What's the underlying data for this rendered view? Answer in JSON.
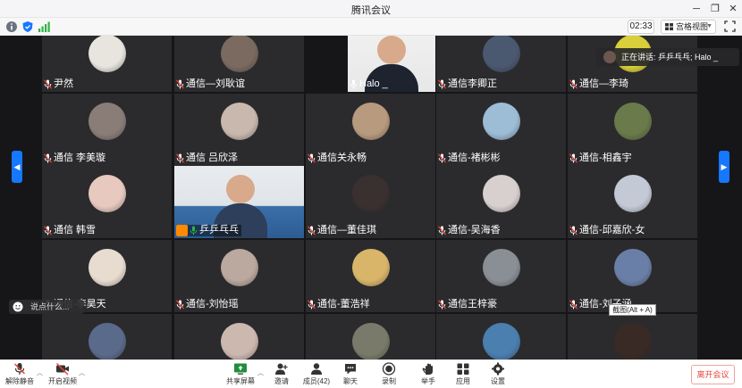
{
  "window": {
    "title": "腾讯会议"
  },
  "toolbar": {
    "timer": "02:33",
    "view_label": "宫格视图"
  },
  "grid": {
    "rows": [
      [
        {
          "name": "尹然",
          "avatar_color": "#e8e4de"
        },
        {
          "name": "通信—刘耿谊",
          "avatar_color": "#7a6a60"
        },
        {
          "name": "Halo _",
          "avatar_color": "#3a4a5a",
          "camera": true
        },
        {
          "name": "通信李卿正",
          "avatar_color": "#4a5870"
        },
        {
          "name": "通信—李琦",
          "avatar_color": "#d9cf3a"
        }
      ],
      [
        {
          "name": "通信 李美璇",
          "avatar_color": "#8a7d78"
        },
        {
          "name": "通信 吕欣泽",
          "avatar_color": "#c9b8ad"
        },
        {
          "name": "通信关永畅",
          "avatar_color": "#b89a7e"
        },
        {
          "name": "通信-褚彬彬",
          "avatar_color": "#9dbcd6"
        },
        {
          "name": "通信-相鑫宇",
          "avatar_color": "#6a7a4a"
        }
      ],
      [
        {
          "name": "通信 韩雪",
          "avatar_color": "#e7c9c0"
        },
        {
          "name": "乒乒乓乓",
          "avatar_color": "#3b5f8a",
          "camera": true,
          "active": true
        },
        {
          "name": "通信—董佳琪",
          "avatar_color": "#3a3030"
        },
        {
          "name": "通信-吴海香",
          "avatar_color": "#d8cfcf"
        },
        {
          "name": "通信-邱嘉欣-女",
          "avatar_color": "#c4c9d6"
        }
      ],
      [
        {
          "name": "通信-李昊天",
          "avatar_color": "#e8dcd0"
        },
        {
          "name": "通信-刘怡瑶",
          "avatar_color": "#bba89e"
        },
        {
          "name": "通信-董浩祥",
          "avatar_color": "#d9b56a"
        },
        {
          "name": "通信王梓豪",
          "avatar_color": "#8a8f95"
        },
        {
          "name": "通信-刘子涵",
          "avatar_color": "#6a7fa8"
        }
      ],
      [
        {
          "name": "",
          "avatar_color": "#5a6a8a"
        },
        {
          "name": "",
          "avatar_color": "#cdb8b0"
        },
        {
          "name": "",
          "avatar_color": "#7a7a6a"
        },
        {
          "name": "",
          "avatar_color": "#4a7fb0"
        },
        {
          "name": "",
          "avatar_color": "#3a2a25"
        }
      ]
    ]
  },
  "overlays": {
    "speaking_text": "正在讲话: 乒乒乓乓; Halo _",
    "chat_placeholder": "说点什么...",
    "tooltip": "截图(Alt + A)"
  },
  "bottom": {
    "mute_label": "解除静音",
    "video_label": "开启视频",
    "share_label": "共享屏幕",
    "invite_label": "邀请",
    "members_label": "成员(42)",
    "chat_label": "聊天",
    "record_label": "录制",
    "raise_label": "举手",
    "apps_label": "应用",
    "settings_label": "设置",
    "leave_label": "离开会议"
  },
  "colors": {
    "accent": "#1677ff",
    "active_outline": "#33c45a",
    "muted_red": "#e8453c",
    "tile_bg": "#2b2b2d"
  }
}
